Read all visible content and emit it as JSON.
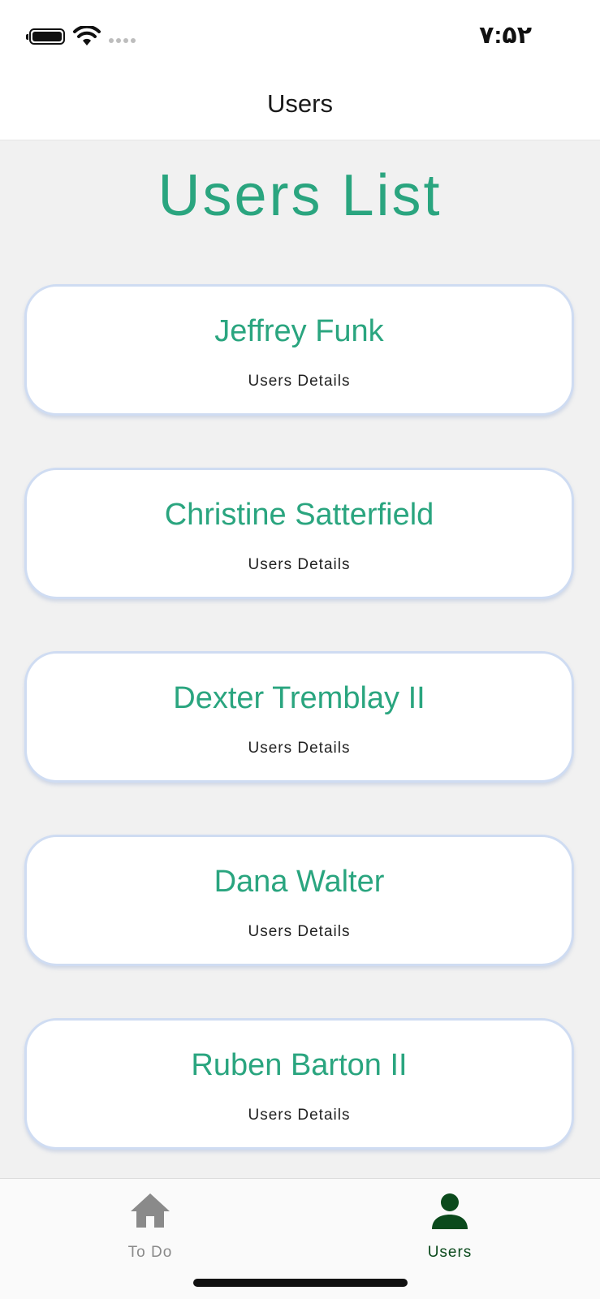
{
  "status_bar": {
    "time": "۷:۵۲",
    "battery_icon": "battery-full-icon",
    "wifi_icon": "wifi-icon",
    "signal_icon": "cellular-signal-icon"
  },
  "header": {
    "title": "Users"
  },
  "main": {
    "heading": "Users List",
    "users": [
      {
        "name": "Jeffrey Funk",
        "details_label": "Users Details"
      },
      {
        "name": "Christine Satterfield",
        "details_label": "Users Details"
      },
      {
        "name": "Dexter Tremblay II",
        "details_label": "Users Details"
      },
      {
        "name": "Dana Walter",
        "details_label": "Users Details"
      },
      {
        "name": "Ruben Barton II",
        "details_label": "Users Details"
      }
    ]
  },
  "tab_bar": {
    "tabs": [
      {
        "label": "To Do",
        "icon": "home-icon",
        "active": false
      },
      {
        "label": "Users",
        "icon": "user-icon",
        "active": true
      }
    ]
  },
  "colors": {
    "accent": "#2aa57f",
    "card_border": "#cfdcf2",
    "active_tab": "#0b4a1c",
    "inactive_tab": "#8a8a8a",
    "background": "#f1f1f1"
  }
}
